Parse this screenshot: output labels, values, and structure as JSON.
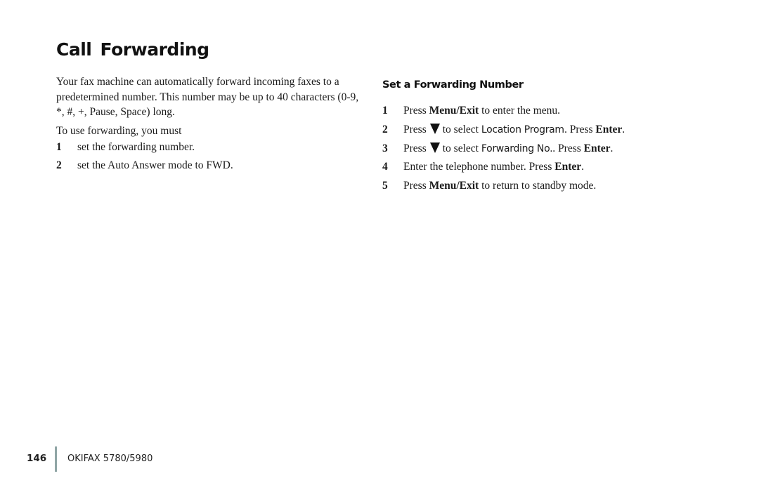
{
  "title": "Call  Forwarding",
  "left": {
    "intro": "Your fax machine can automatically forward incoming faxes to a predetermined number.  This number may be up to 40 characters (0-9, *, #, +, Pause, Space) long.",
    "lead": "To use forwarding, you must",
    "steps": [
      {
        "num": "1",
        "text": "set the forwarding number."
      },
      {
        "num": "2",
        "text": "set the Auto Answer mode to FWD."
      }
    ]
  },
  "right": {
    "heading": "Set a Forwarding Number",
    "steps": [
      {
        "num": "1",
        "pre": "Press ",
        "bold1": "Menu/Exit",
        "post": " to enter the menu."
      },
      {
        "num": "2",
        "pre": "Press",
        "icon": "down-triangle-icon",
        "mid": "to select ",
        "lcd": "Location Program.",
        "mid2": " Press ",
        "bold2": "Enter",
        "end": "."
      },
      {
        "num": "3",
        "pre": "Press",
        "icon": "down-triangle-icon",
        "mid": "to select ",
        "lcd": "Forwarding No.",
        "mid2": ". Press ",
        "bold2": "Enter",
        "end": "."
      },
      {
        "num": "4",
        "pre": "Enter the telephone number. Press ",
        "bold1": "Enter",
        "post": "."
      },
      {
        "num": "5",
        "pre": "Press ",
        "bold1": "Menu/Exit",
        "post": " to return to standby mode."
      }
    ]
  },
  "footer": {
    "page_number": "146",
    "product": "OKIFAX 5780/5980",
    "divider_color": "#8fa5a5"
  }
}
